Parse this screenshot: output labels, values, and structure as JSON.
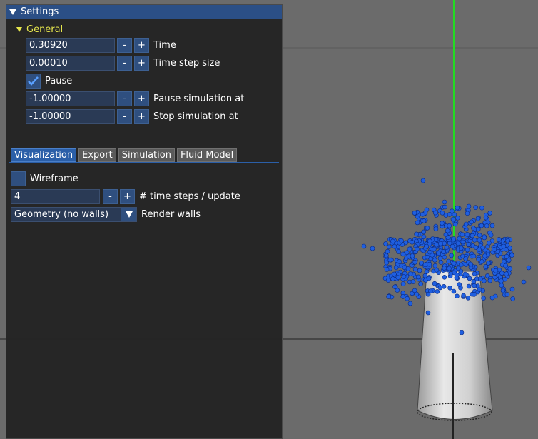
{
  "window": {
    "title": "Settings"
  },
  "general": {
    "header": "General",
    "time": {
      "value": "0.30920",
      "label": "Time"
    },
    "time_step": {
      "value": "0.00010",
      "label": "Time step size"
    },
    "pause": {
      "label": "Pause",
      "checked": true
    },
    "pause_at": {
      "value": "-1.00000",
      "label": "Pause simulation at"
    },
    "stop_at": {
      "value": "-1.00000",
      "label": "Stop simulation at"
    }
  },
  "buttons": {
    "minus": "-",
    "plus": "+"
  },
  "tabs": [
    {
      "label": "Visualization",
      "active": true
    },
    {
      "label": "Export",
      "active": false
    },
    {
      "label": "Simulation",
      "active": false
    },
    {
      "label": "Fluid Model",
      "active": false
    }
  ],
  "visualization": {
    "wireframe": {
      "label": "Wireframe",
      "checked": false
    },
    "steps_per_update": {
      "value": "4",
      "label": "# time steps / update"
    },
    "render_walls": {
      "selected": "Geometry (no walls)",
      "label": "Render walls"
    }
  },
  "icons": {
    "collapse": "triangle-down-icon",
    "check": "checkmark-icon",
    "combo": "chevron-down-icon"
  },
  "colors": {
    "title_bar": "#2b4f86",
    "header_text": "#e6e64d",
    "particles": "#1f5fe0",
    "axis_green": "#22dd22",
    "background": "#6b6b6b"
  }
}
